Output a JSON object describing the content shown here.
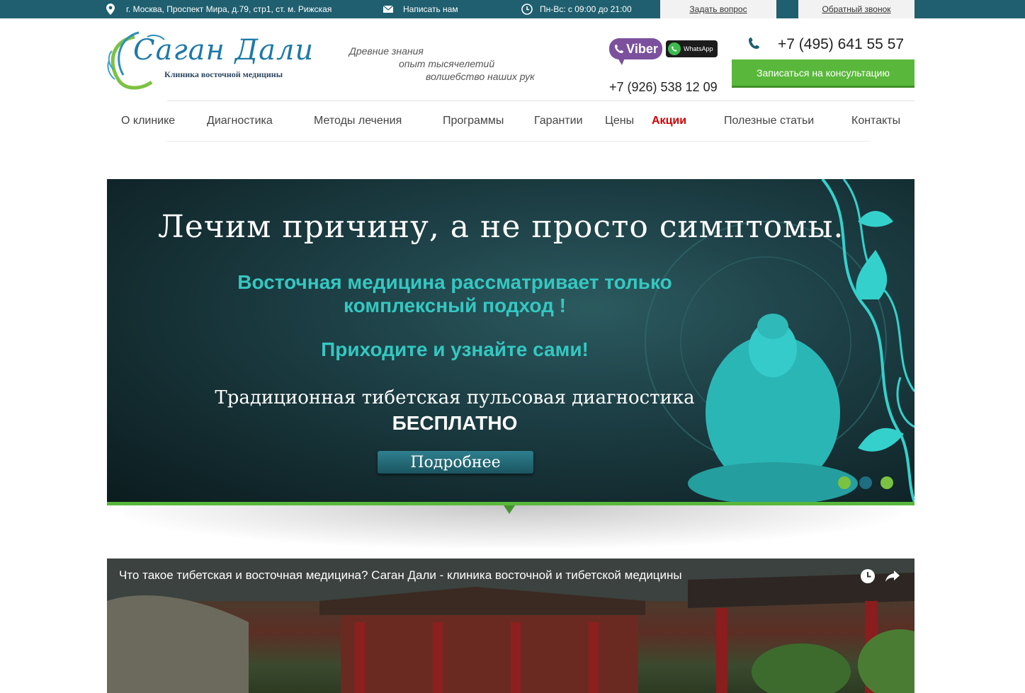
{
  "topbar": {
    "address": "г. Москва, Проспект Мира, д.79, стр1, ст. м. Рижская",
    "write_us": "Написать нам",
    "hours": "Пн-Вс: с 09:00 до 21:00",
    "ask_question": "Задать вопрос",
    "callback": "Обратный звонок"
  },
  "header": {
    "logo_title": "Саган Дали",
    "logo_subtitle": "Клиника восточной медицины",
    "tagline": [
      "Древние знания",
      "опыт тысячелетий",
      "волшебство наших рук"
    ],
    "viber_label": "Viber",
    "whatsapp_label": "WhatsApp",
    "phone_main": "+7 (495) 641 55 57",
    "phone_mobile": "+7 (926) 538 12 09",
    "consult_button": "Записаться на консультацию"
  },
  "nav": [
    {
      "label": "О клинике"
    },
    {
      "label": "Диагностика"
    },
    {
      "label": "Методы лечения"
    },
    {
      "label": "Программы"
    },
    {
      "label": "Гарантии"
    },
    {
      "label": "Цены"
    },
    {
      "label": "Акции"
    },
    {
      "label": "Полезные статьи"
    },
    {
      "label": "Контакты"
    }
  ],
  "slider": {
    "title": "Лечим причину,  а не просто симптомы.",
    "line1": "Восточная медицина рассматривает только",
    "line2": "комплексный подход !",
    "line3": "Приходите и узнайте сами!",
    "line4": "Традиционная тибетская пульсовая диагностика",
    "line5": "БЕСПЛАТНО",
    "button": "Подробнее"
  },
  "video": {
    "title": "Что такое тибетская и восточная медицина? Саган Дали - клиника восточной и тибетской медицины"
  },
  "colors": {
    "topbar": "#1f5f6f",
    "green": "#59b83b",
    "teal_text": "#35c7c1",
    "accent_red": "#d20000",
    "viber": "#7b519d"
  }
}
